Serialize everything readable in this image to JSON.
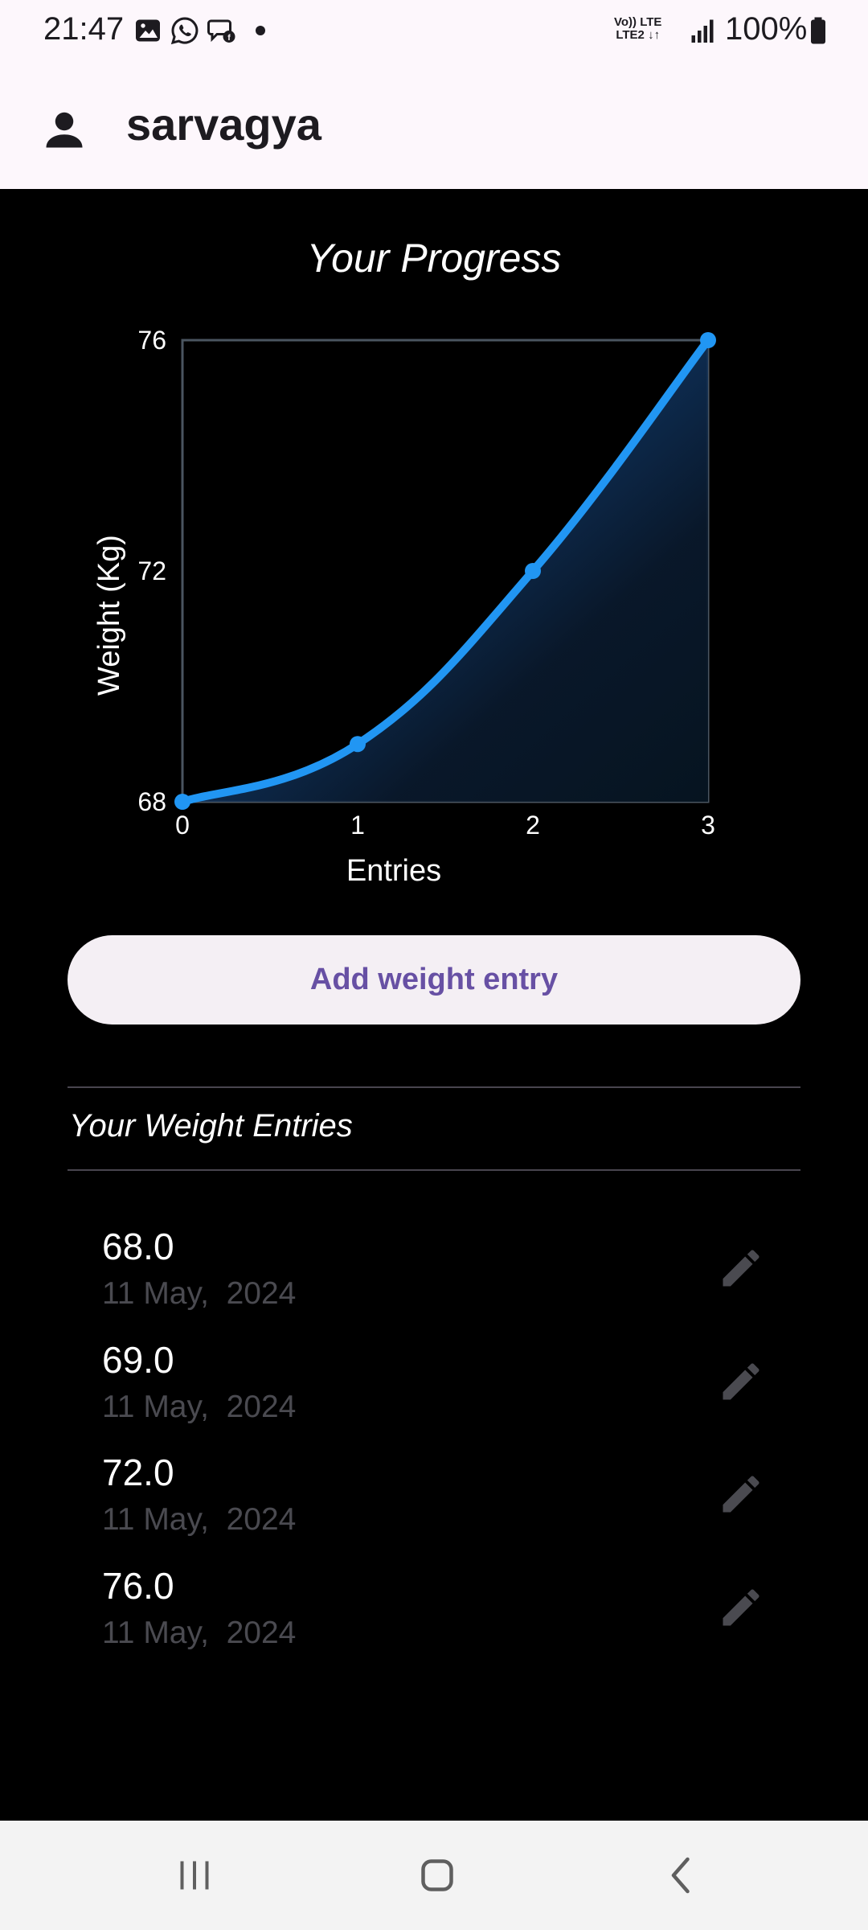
{
  "status_bar": {
    "time": "21:47",
    "network_label": "Vo)) LTE\nLTE2 ↓↑",
    "battery": "100%",
    "icons": [
      "gallery-icon",
      "whatsapp-icon",
      "chat-icon",
      "signal-icon",
      "battery-icon"
    ]
  },
  "app_bar": {
    "icon": "person-icon",
    "title": "sarvagya"
  },
  "chart": {
    "title": "Your Progress"
  },
  "chart_data": {
    "type": "line",
    "title": "Your Progress",
    "xlabel": "Entries",
    "ylabel": "Weight (Kg)",
    "x": [
      0,
      1,
      2,
      3
    ],
    "y": [
      68,
      69,
      72,
      76
    ],
    "xlim": [
      0,
      3
    ],
    "ylim": [
      68,
      76
    ],
    "x_ticks": [
      "0",
      "1",
      "2",
      "3"
    ],
    "y_ticks": [
      "68",
      "72",
      "76"
    ],
    "smooth": true,
    "area_fill": true,
    "grid": false,
    "line_color": "#2196f3"
  },
  "add_button": {
    "label": "Add weight entry"
  },
  "entries_section": {
    "title": "Your Weight Entries",
    "items": [
      {
        "weight": "68.0",
        "date": "11 May,  2024"
      },
      {
        "weight": "69.0",
        "date": "11 May,  2024"
      },
      {
        "weight": "72.0",
        "date": "11 May,  2024"
      },
      {
        "weight": "76.0",
        "date": "11 May,  2024"
      }
    ],
    "edit_icon": "edit-icon"
  },
  "nav_bar": {
    "icons": [
      "recent-apps-icon",
      "home-icon",
      "back-icon"
    ]
  },
  "colors": {
    "accent": "#2196f3",
    "button_text": "#6750a4",
    "button_bg": "#f4eff4",
    "background": "#000000"
  }
}
